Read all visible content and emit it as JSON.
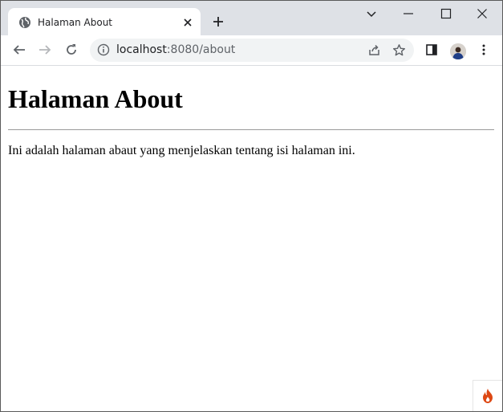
{
  "browser": {
    "tab": {
      "title": "Halaman About"
    },
    "address_bar": {
      "host": "localhost",
      "rest": ":8080/about"
    }
  },
  "page": {
    "heading": "Halaman About",
    "paragraph": "Ini adalah halaman abaut yang menjelaskan tentang isi halaman ini."
  },
  "icons": {
    "tab_favicon": "globe-icon",
    "tab_close": "close-icon",
    "new_tab": "plus-icon",
    "tab_search": "chevron-down-icon",
    "minimize": "minimize-icon",
    "maximize": "maximize-icon",
    "close_window": "close-icon",
    "back": "arrow-left-icon",
    "forward": "arrow-right-icon",
    "reload": "reload-icon",
    "site_info": "info-icon",
    "share": "share-icon",
    "bookmark": "star-icon",
    "side_panel": "side-panel-icon",
    "profile": "avatar",
    "menu": "kebab-menu-icon",
    "debug_toolbar": "flame-icon"
  },
  "colors": {
    "tabstrip_bg": "#dee1e6",
    "omnibox_bg": "#f1f3f4",
    "flame": "#dd4814"
  }
}
